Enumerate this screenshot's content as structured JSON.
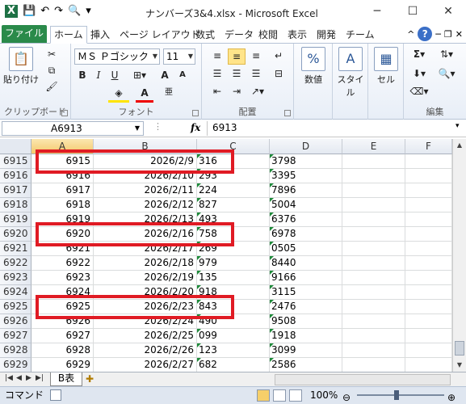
{
  "window": {
    "title": "ナンバーズ3&4.xlsx - Microsoft Excel",
    "controls": [
      "─",
      "☐",
      "✕"
    ]
  },
  "ribbon_tabs": [
    "ファイル",
    "ホーム",
    "挿入",
    "ページ レイアウト",
    "数式",
    "データ",
    "校閲",
    "表示",
    "開発",
    "チーム"
  ],
  "ribbon": {
    "clipboard": {
      "paste": "貼り付け",
      "label": "クリップボード"
    },
    "font": {
      "name": "ＭＳ Ｐゴシック",
      "size": "11",
      "label": "フォント"
    },
    "alignment": {
      "label": "配置"
    },
    "number": {
      "button": "数値",
      "percent": "%"
    },
    "styles": {
      "button": "スタイル"
    },
    "cells": {
      "button": "セル"
    },
    "editing": {
      "label": "編集"
    }
  },
  "formula_bar": {
    "name_box": "A6913",
    "fx": "fx",
    "value": "6913"
  },
  "grid": {
    "columns": [
      "A",
      "B",
      "C",
      "D",
      "E",
      "F"
    ],
    "rows": [
      {
        "row": "6915",
        "a": "6915",
        "b": "2026/2/9",
        "c": "316",
        "d": "3798"
      },
      {
        "row": "6916",
        "a": "6916",
        "b": "2026/2/10",
        "c": "293",
        "d": "3395"
      },
      {
        "row": "6917",
        "a": "6917",
        "b": "2026/2/11",
        "c": "224",
        "d": "7896"
      },
      {
        "row": "6918",
        "a": "6918",
        "b": "2026/2/12",
        "c": "827",
        "d": "5004"
      },
      {
        "row": "6919",
        "a": "6919",
        "b": "2026/2/13",
        "c": "493",
        "d": "6376"
      },
      {
        "row": "6920",
        "a": "6920",
        "b": "2026/2/16",
        "c": "758",
        "d": "6978"
      },
      {
        "row": "6921",
        "a": "6921",
        "b": "2026/2/17",
        "c": "269",
        "d": "0505"
      },
      {
        "row": "6922",
        "a": "6922",
        "b": "2026/2/18",
        "c": "979",
        "d": "8440"
      },
      {
        "row": "6923",
        "a": "6923",
        "b": "2026/2/19",
        "c": "135",
        "d": "9166"
      },
      {
        "row": "6924",
        "a": "6924",
        "b": "2026/2/20",
        "c": "918",
        "d": "3115"
      },
      {
        "row": "6925",
        "a": "6925",
        "b": "2026/2/23",
        "c": "843",
        "d": "2476"
      },
      {
        "row": "6926",
        "a": "6926",
        "b": "2026/2/24",
        "c": "490",
        "d": "9508"
      },
      {
        "row": "6927",
        "a": "6927",
        "b": "2026/2/25",
        "c": "099",
        "d": "1918"
      },
      {
        "row": "6928",
        "a": "6928",
        "b": "2026/2/26",
        "c": "123",
        "d": "3099"
      },
      {
        "row": "6929",
        "a": "6929",
        "b": "2026/2/27",
        "c": "682",
        "d": "2586"
      }
    ]
  },
  "sheet_tab": "B表",
  "status": {
    "mode": "コマンド",
    "zoom": "100%",
    "zoom_minus": "⊖",
    "zoom_plus": "⊕"
  },
  "colors": {
    "file_tab": "#2a8a4a",
    "highlight_box": "#e01b24",
    "text_indicator": "#1e8a3a"
  }
}
